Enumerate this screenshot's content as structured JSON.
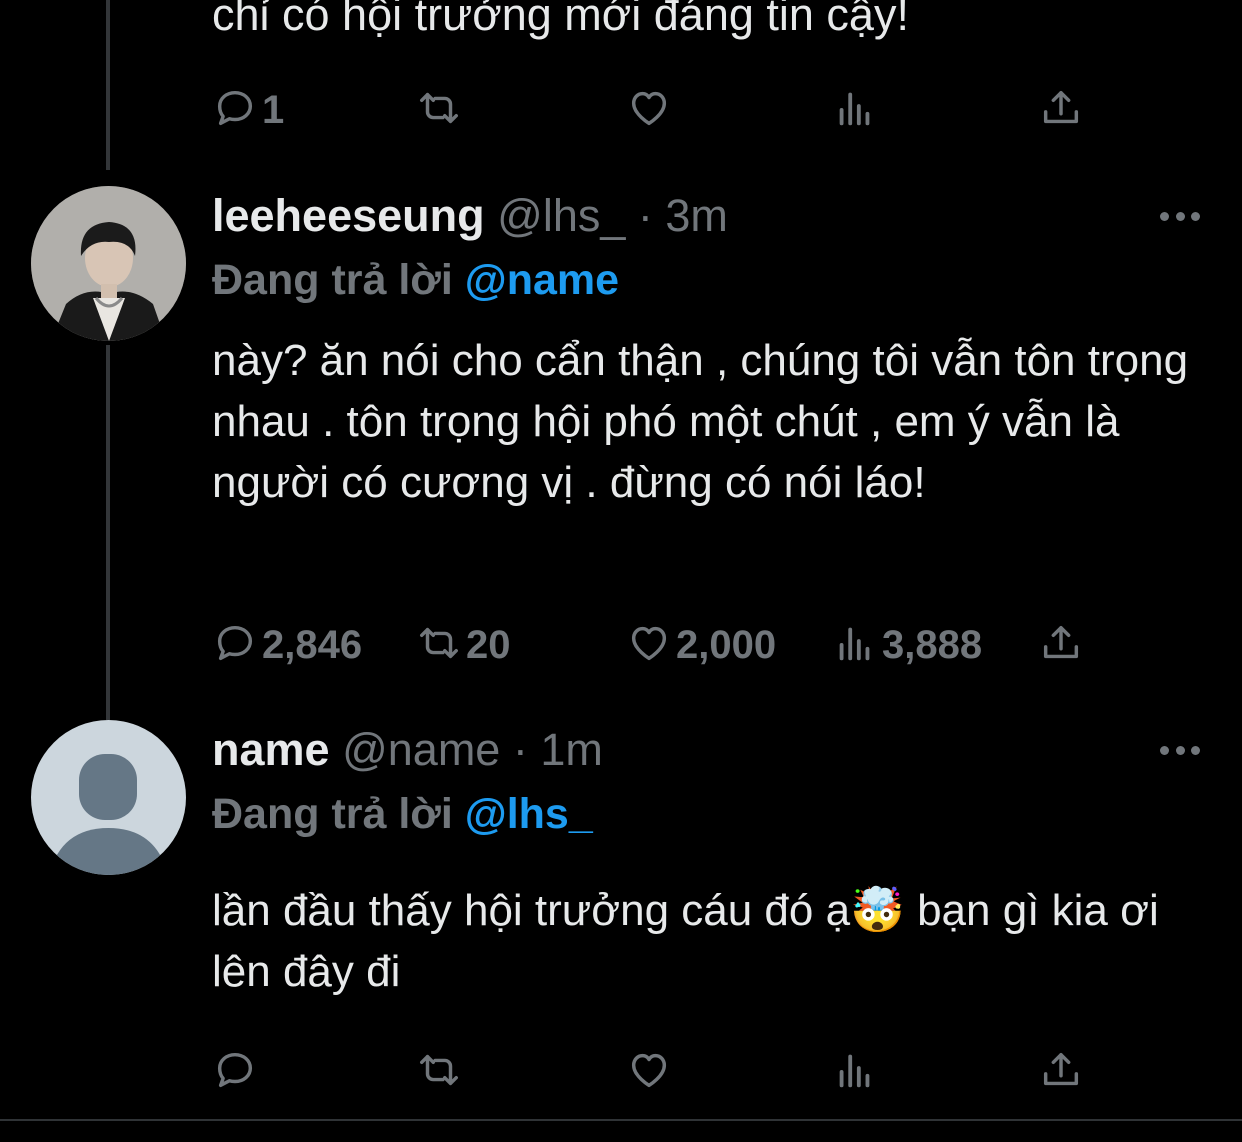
{
  "prev_tweet": {
    "text": "chỉ có hội trưởng mới đáng tin cậy!",
    "actions": {
      "reply": "1",
      "retweet": "",
      "like": "",
      "views": ""
    }
  },
  "tweets": [
    {
      "name": "leeheeseung",
      "handle": "@lhs_",
      "time": "3m",
      "replying_prefix": "Đang trả lời",
      "replying_to": "@name",
      "body": "này? ăn nói cho cẩn thận , chúng tôi vẫn tôn trọng nhau . tôn trọng hội phó một chút , em ý vẫn là người có cương vị . đừng có nói láo!",
      "actions": {
        "reply": "2,846",
        "retweet": "20",
        "like": "2,000",
        "views": "3,888"
      }
    },
    {
      "name": "name",
      "handle": "@name",
      "time": "1m",
      "replying_prefix": "Đang trả lời",
      "replying_to": "@lhs_",
      "body": "lần đầu thấy hội trưởng cáu đó ạ🤯 bạn gì kia ơi lên đây đi",
      "actions": {
        "reply": "",
        "retweet": "",
        "like": "",
        "views": ""
      }
    }
  ],
  "separator": "·",
  "colors": {
    "background": "#000000",
    "text": "#e7e9ea",
    "muted": "#71767b",
    "mention": "#1d9bf0"
  },
  "icons": [
    "reply-icon",
    "retweet-icon",
    "like-icon",
    "views-icon",
    "share-icon",
    "more-icon"
  ]
}
